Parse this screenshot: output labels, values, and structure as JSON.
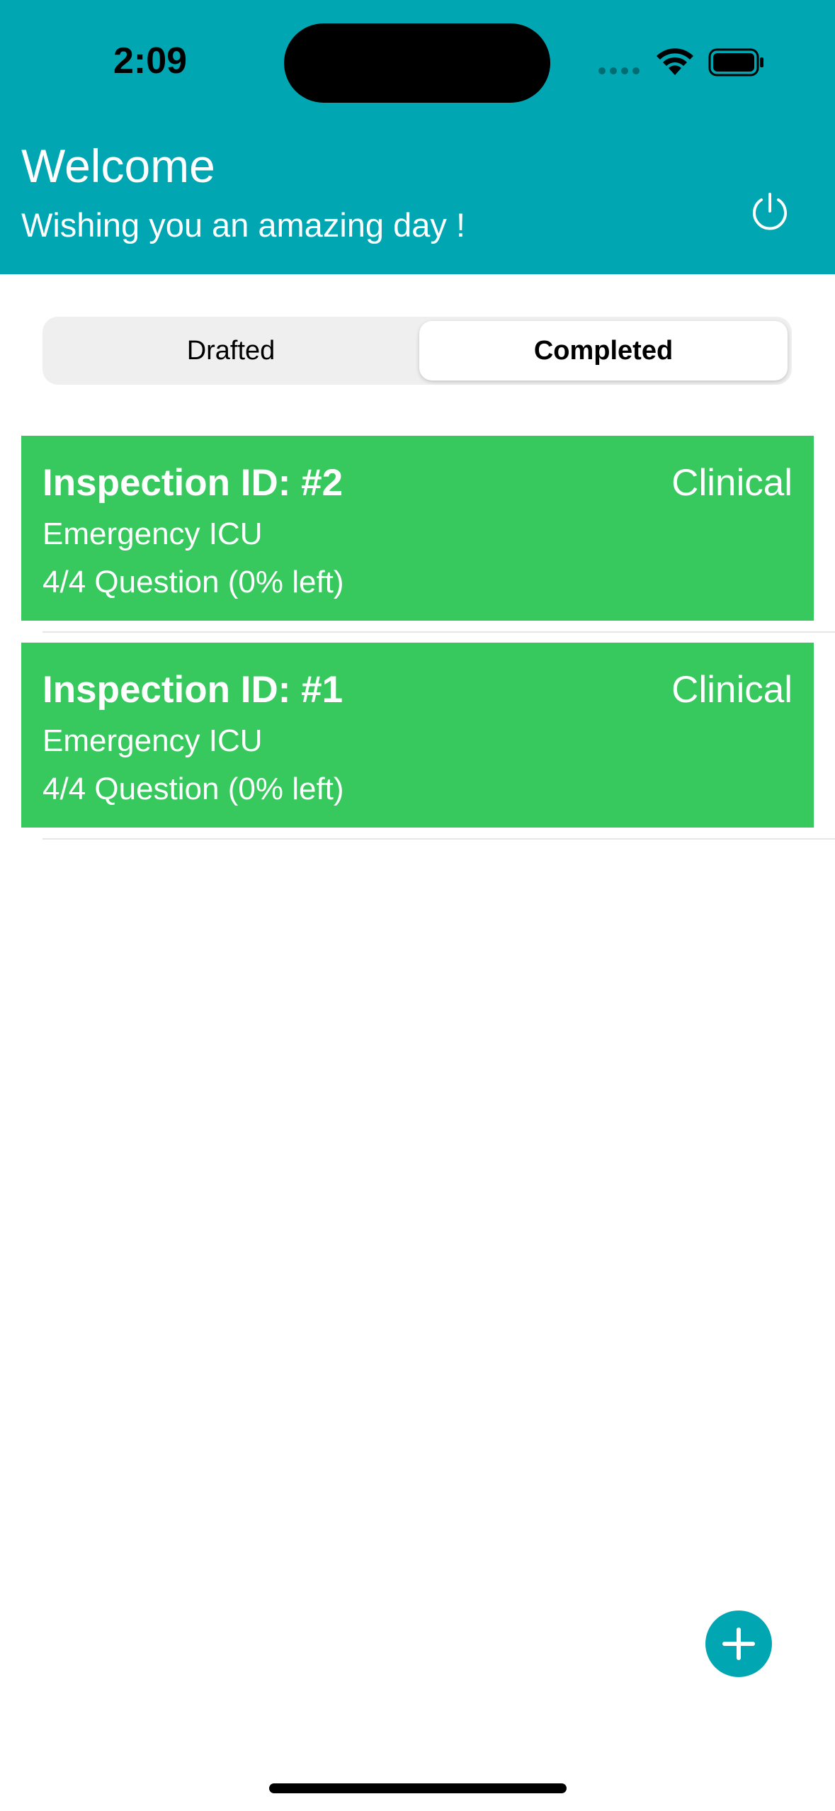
{
  "status_bar": {
    "time": "2:09"
  },
  "header": {
    "title": "Welcome",
    "subtitle": "Wishing you an amazing day !"
  },
  "tabs": {
    "items": [
      {
        "label": "Drafted",
        "selected": false
      },
      {
        "label": "Completed",
        "selected": true
      }
    ]
  },
  "inspections": [
    {
      "title": "Inspection ID: #2",
      "category": "Clinical",
      "department": "Emergency ICU",
      "progress": "4/4 Question (0% left)"
    },
    {
      "title": "Inspection ID: #1",
      "category": "Clinical",
      "department": "Emergency ICU",
      "progress": "4/4 Question (0% left)"
    }
  ],
  "colors": {
    "header": "#00A6B2",
    "card": "#37C95E",
    "accent": "#00A6B2"
  },
  "icons": {
    "power": "power-icon",
    "add": "plus-icon",
    "wifi": "wifi-icon",
    "battery": "battery-icon"
  }
}
